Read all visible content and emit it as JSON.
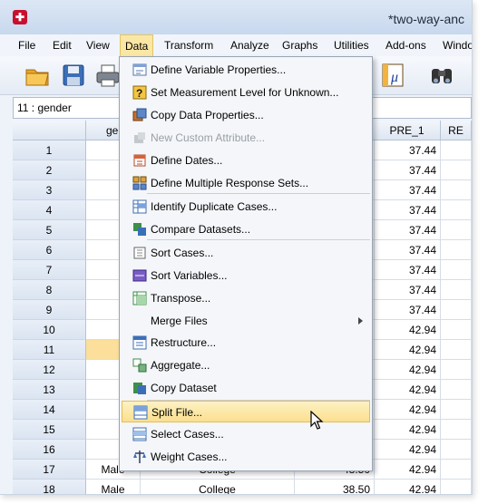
{
  "window": {
    "title": "*two-way-anc"
  },
  "menubar": [
    "File",
    "Edit",
    "View",
    "Data",
    "Transform",
    "Analyze",
    "Graphs",
    "Utilities",
    "Add-ons",
    "Windo"
  ],
  "cell_ref": "11 : gender",
  "columns": {
    "gender": "ge",
    "pre1": "PRE_1",
    "next": "RE"
  },
  "rows": [
    {
      "n": "1",
      "pre": "37.44"
    },
    {
      "n": "2",
      "pre": "37.44"
    },
    {
      "n": "3",
      "pre": "37.44"
    },
    {
      "n": "4",
      "pre": "37.44"
    },
    {
      "n": "5",
      "pre": "37.44"
    },
    {
      "n": "6",
      "pre": "37.44"
    },
    {
      "n": "7",
      "pre": "37.44"
    },
    {
      "n": "8",
      "pre": "37.44"
    },
    {
      "n": "9",
      "pre": "37.44"
    },
    {
      "n": "10",
      "pre": "42.94"
    },
    {
      "n": "11",
      "pre": "42.94"
    },
    {
      "n": "12",
      "pre": "42.94"
    },
    {
      "n": "13",
      "pre": "42.94"
    },
    {
      "n": "14",
      "pre": "42.94"
    },
    {
      "n": "15",
      "pre": "42.94"
    },
    {
      "n": "16",
      "pre": "42.94"
    },
    {
      "n": "17",
      "pre": "42.94",
      "g": "Male",
      "e": "College",
      "v": "48.50"
    },
    {
      "n": "18",
      "pre": "42.94",
      "g": "Male",
      "e": "College",
      "v": "38.50"
    }
  ],
  "data_menu": [
    {
      "label": "Define Variable Properties...",
      "icon": "define-variable-properties-icon"
    },
    {
      "label": "Set Measurement Level for Unknown...",
      "icon": "set-measurement-level-icon"
    },
    {
      "label": "Copy Data Properties...",
      "icon": "copy-data-properties-icon"
    },
    {
      "label": "New Custom Attribute...",
      "icon": "new-custom-attribute-icon",
      "disabled": true
    },
    {
      "label": "Define Dates...",
      "icon": "define-dates-icon"
    },
    {
      "label": "Define Multiple Response Sets...",
      "icon": "multiple-response-sets-icon"
    },
    {
      "label": "Identify Duplicate Cases...",
      "icon": "identify-duplicates-icon"
    },
    {
      "label": "Compare Datasets...",
      "icon": "compare-datasets-icon"
    },
    {
      "label": "Sort Cases...",
      "icon": "sort-cases-icon"
    },
    {
      "label": "Sort Variables...",
      "icon": "sort-variables-icon"
    },
    {
      "label": "Transpose...",
      "icon": "transpose-icon"
    },
    {
      "label": "Merge Files",
      "icon": "",
      "submenu": true
    },
    {
      "label": "Restructure...",
      "icon": "restructure-icon"
    },
    {
      "label": "Aggregate...",
      "icon": "aggregate-icon"
    },
    {
      "label": "Copy Dataset",
      "icon": "copy-dataset-icon"
    },
    {
      "label": "Split File...",
      "icon": "split-file-icon",
      "highlight": true
    },
    {
      "label": "Select Cases...",
      "icon": "select-cases-icon"
    },
    {
      "label": "Weight Cases...",
      "icon": "weight-cases-icon"
    }
  ]
}
